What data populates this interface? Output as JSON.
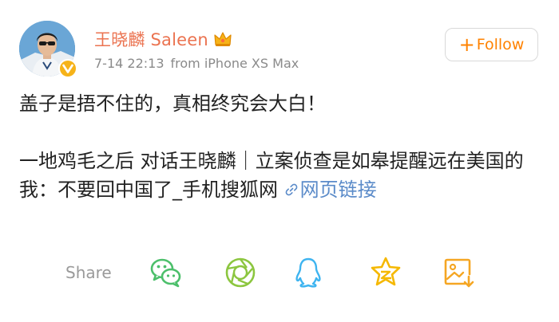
{
  "post": {
    "author": {
      "name": "王晓麟 Saleen",
      "badge_icon": "crown-icon",
      "verified_icon": "verified-v-icon",
      "name_color": "#eb7350"
    },
    "meta": {
      "timestamp": "7-14 22:13",
      "source": "from iPhone XS Max"
    },
    "follow_button": {
      "label": "Follow",
      "icon": "plus-icon",
      "color": "#ff8200"
    },
    "content": {
      "line1": "盖子是捂不住的，真相终究会大白！",
      "line2": "一地鸡毛之后 对话王晓麟｜立案侦查是如皋提醒远在美国的我：不要回中国了_手机搜狐网 ",
      "link_label": "网页链接",
      "link_icon": "link-icon",
      "link_color": "#5b8bc9"
    }
  },
  "share": {
    "label": "Share",
    "targets": [
      {
        "name": "wechat-icon",
        "color": "#4cbf6b"
      },
      {
        "name": "moments-icon",
        "color": "#8cc63f"
      },
      {
        "name": "qq-icon",
        "color": "#3eb4f0"
      },
      {
        "name": "qzone-icon",
        "color": "#f5b800"
      },
      {
        "name": "save-image-icon",
        "color": "#f5a623"
      }
    ]
  }
}
